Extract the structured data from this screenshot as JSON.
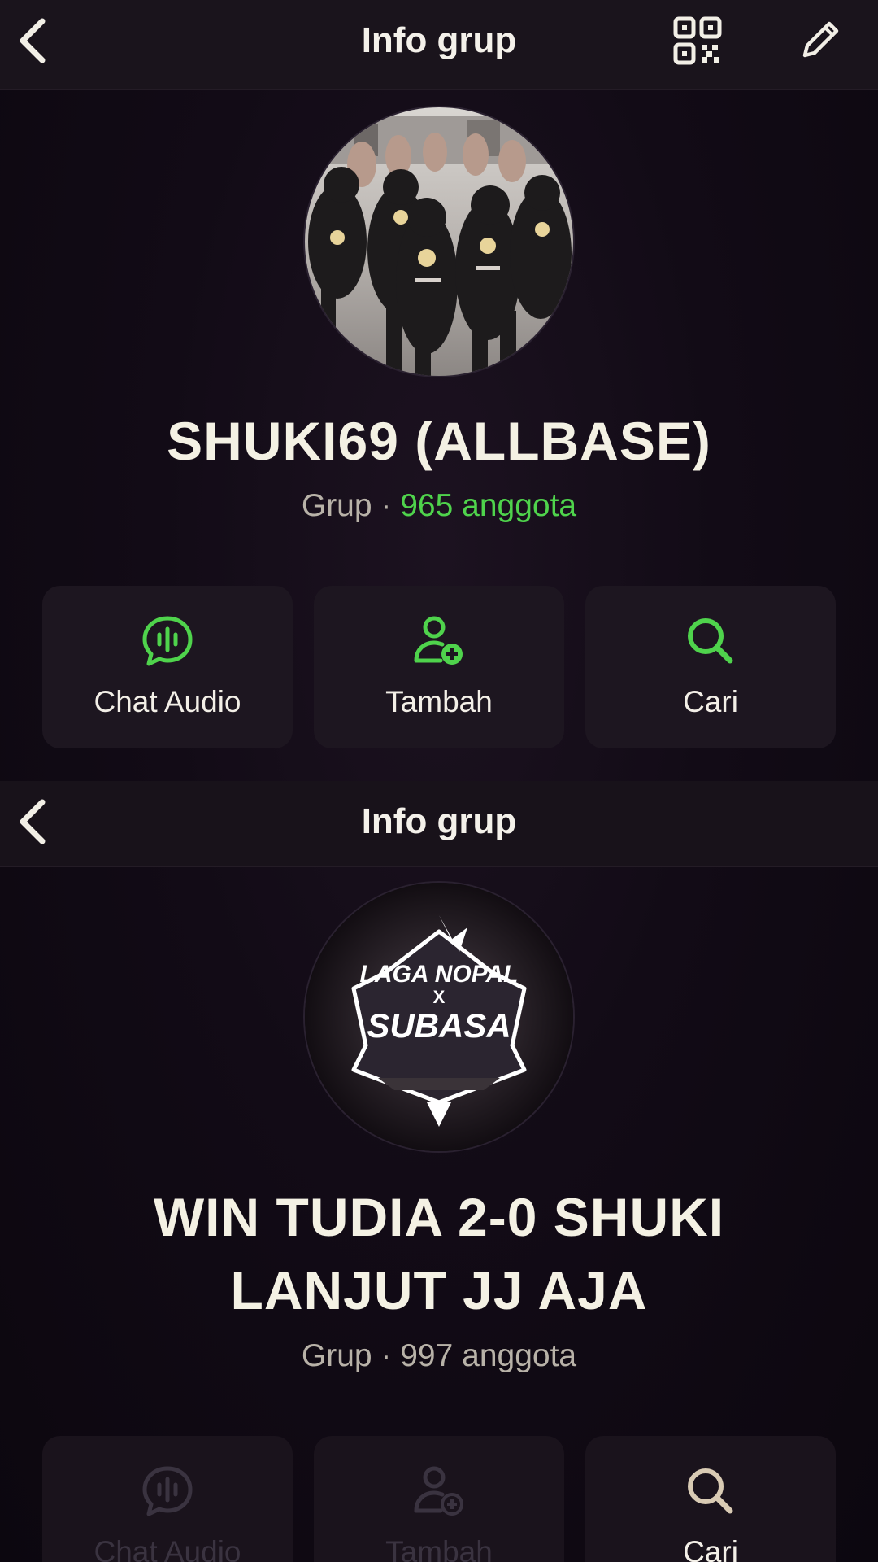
{
  "top_panel": {
    "header": {
      "title": "Info grup"
    },
    "group": {
      "name": "SHUKI69 (ALLBASE)",
      "meta_prefix": "Grup · ",
      "members": "965 anggota"
    },
    "actions": [
      {
        "label": "Chat Audio",
        "icon": "audio-chat-icon"
      },
      {
        "label": "Tambah",
        "icon": "add-person-icon"
      },
      {
        "label": "Cari",
        "icon": "search-icon"
      }
    ]
  },
  "bottom_panel": {
    "header": {
      "title": "Info grup"
    },
    "avatar_logo": {
      "line1": "LAGA NOPAL",
      "line2": "X",
      "line3": "SUBASA"
    },
    "group": {
      "name_line1": "WIN TUDIA 2-0 SHUKI",
      "name_line2": "LANJUT JJ AJA",
      "meta": "Grup · 997 anggota"
    },
    "actions": [
      {
        "label": "Chat Audio",
        "icon": "audio-chat-icon"
      },
      {
        "label": "Tambah",
        "icon": "add-person-icon"
      },
      {
        "label": "Cari",
        "icon": "search-icon"
      }
    ]
  },
  "colors": {
    "accent_green": "#4fd34c",
    "background": "#120b16",
    "card": "#1d1620"
  }
}
